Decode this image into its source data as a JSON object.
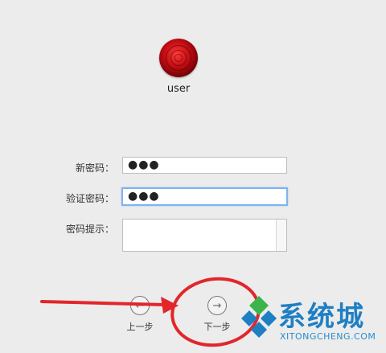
{
  "user": {
    "name": "user"
  },
  "form": {
    "new_password_label": "新密码：",
    "new_password_value": "●●●",
    "verify_password_label": "验证密码：",
    "verify_password_value": "●●●",
    "hint_label": "密码提示："
  },
  "nav": {
    "back_label": "上一步",
    "next_label": "下一步",
    "back_icon": "arrow-left-circle",
    "next_icon": "arrow-right-circle"
  },
  "watermark": {
    "title": "系统城",
    "subtitle": "XITONGCHENG.COM",
    "colors": {
      "blue": "#1f7fc3",
      "green": "#3bb54a"
    }
  },
  "annotation_color": "#e2262a"
}
